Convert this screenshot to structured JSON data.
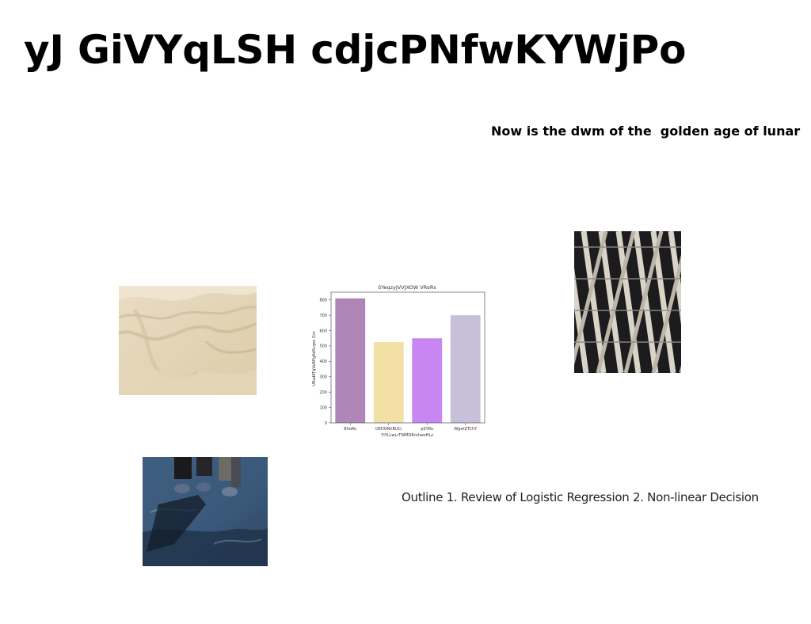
{
  "slide": {
    "title": "yJ GiVYqLSH cdjcPNfwKYWjPo",
    "subheading": "Now is the dwm of the  golden age of lunar",
    "outline": "Outline 1. Review of Logistic Regression 2. Non-linear Decision"
  },
  "chart_data": {
    "type": "bar",
    "title": "SYeqzyJVVJXOW VRoRs",
    "xlabel": "YIYLLwLrTWMDRmhwzHLz",
    "ylabel": "URsdKTqVoRPgAdSvgss Gm",
    "categories": [
      "BhoRo",
      "OXHONhBUCi",
      "pSYRu",
      "WgetZTChY"
    ],
    "values": [
      810,
      525,
      550,
      700
    ],
    "colors": [
      "#b085b8",
      "#f2e0a4",
      "#c786f2",
      "#c8c0da"
    ],
    "ylim": [
      0,
      850
    ],
    "yticks": [
      0,
      100,
      200,
      300,
      400,
      500,
      600,
      700,
      800
    ],
    "grid": false
  }
}
